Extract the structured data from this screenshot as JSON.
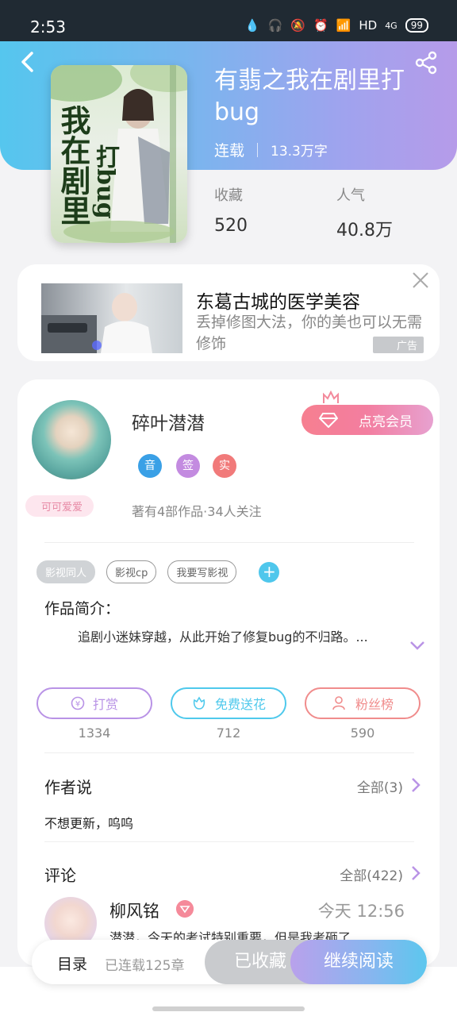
{
  "status_bar": {
    "time": "2:53",
    "network": "HD",
    "signal": "4G",
    "battery": "99"
  },
  "book": {
    "title": "有翡之我在剧里打bug",
    "status": "连载",
    "word_count": "13.3万字",
    "cover_title_1": "我在剧里",
    "cover_title_2": "打bug",
    "favorites_label": "收藏",
    "favorites_value": "520",
    "popularity_label": "人气",
    "popularity_value": "40.8万"
  },
  "ad": {
    "title": "东葛古城的医学美容",
    "description": "丢掉修图大法，你的美也可以无需修饰",
    "tag": "广告"
  },
  "author": {
    "name": "碎叶潜潜",
    "badge": "可可爱爱",
    "vip_button": "点亮会员",
    "icons": [
      "音",
      "签",
      "实"
    ],
    "stats": "著有4部作品·34人关注"
  },
  "tags": [
    "影视同人",
    "影视cp",
    "我要写影视"
  ],
  "intro": {
    "heading": "作品简介：",
    "text": "追剧小迷妹穿越，从此开始了修复bug的不归路。..."
  },
  "actions": [
    {
      "label": "打赏",
      "count": "1334",
      "color": "#b993e6"
    },
    {
      "label": "免费送花",
      "count": "712",
      "color": "#4fc9ec"
    },
    {
      "label": "粉丝榜",
      "count": "590",
      "color": "#f08c8c"
    }
  ],
  "author_say": {
    "heading": "作者说",
    "more": "全部(3)",
    "text": "不想更新，呜呜"
  },
  "comments": {
    "heading": "评论",
    "more": "全部(422)",
    "first": {
      "user": "柳风铭",
      "time": "今天 12:56",
      "text": "潜潜，今天的考试特别重要，但是我考砸了"
    }
  },
  "bottom_bar": {
    "toc": "目录",
    "toc_info": "已连载125章",
    "favorited": "已收藏",
    "continue": "继续阅读"
  }
}
